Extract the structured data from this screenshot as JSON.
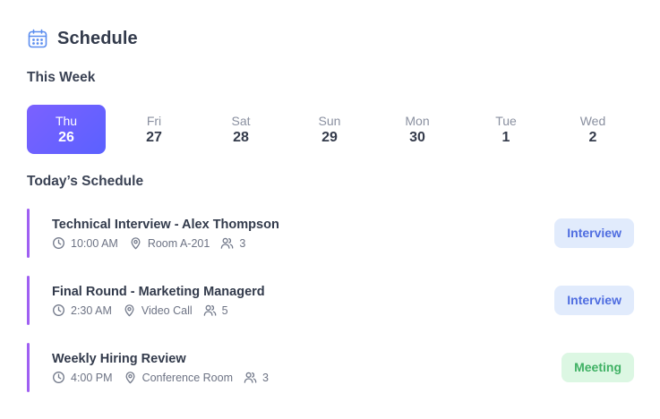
{
  "header": {
    "title": "Schedule",
    "icon": "calendar-icon",
    "accent": "#5b8def"
  },
  "week": {
    "label": "This Week",
    "days": [
      {
        "name": "Thu",
        "num": "26",
        "active": true
      },
      {
        "name": "Fri",
        "num": "27",
        "active": false
      },
      {
        "name": "Sat",
        "num": "28",
        "active": false
      },
      {
        "name": "Sun",
        "num": "29",
        "active": false
      },
      {
        "name": "Mon",
        "num": "30",
        "active": false
      },
      {
        "name": "Tue",
        "num": "1",
        "active": false
      },
      {
        "name": "Wed",
        "num": "2",
        "active": false
      }
    ]
  },
  "today": {
    "label": "Today’s Schedule",
    "events": [
      {
        "title": "Technical Interview - Alex Thompson",
        "time": "10:00 AM",
        "location": "Room A-201",
        "attendees": "3",
        "badge": "Interview",
        "badge_type": "interview"
      },
      {
        "title": "Final Round - Marketing Managerd",
        "time": "2:30 AM",
        "location": "Video Call",
        "attendees": "5",
        "badge": "Interview",
        "badge_type": "interview"
      },
      {
        "title": "Weekly Hiring Review",
        "time": "4:00 PM",
        "location": "Conference Room",
        "attendees": "3",
        "badge": "Meeting",
        "badge_type": "meeting"
      }
    ]
  },
  "colors": {
    "active_day_gradient_start": "#7b61ff",
    "active_day_gradient_end": "#5b61ff",
    "event_bar": "#9f5ff2",
    "interview_bg": "#e1ebfc",
    "interview_text": "#4f6de0",
    "meeting_bg": "#dcf7e3",
    "meeting_text": "#3fb164"
  }
}
